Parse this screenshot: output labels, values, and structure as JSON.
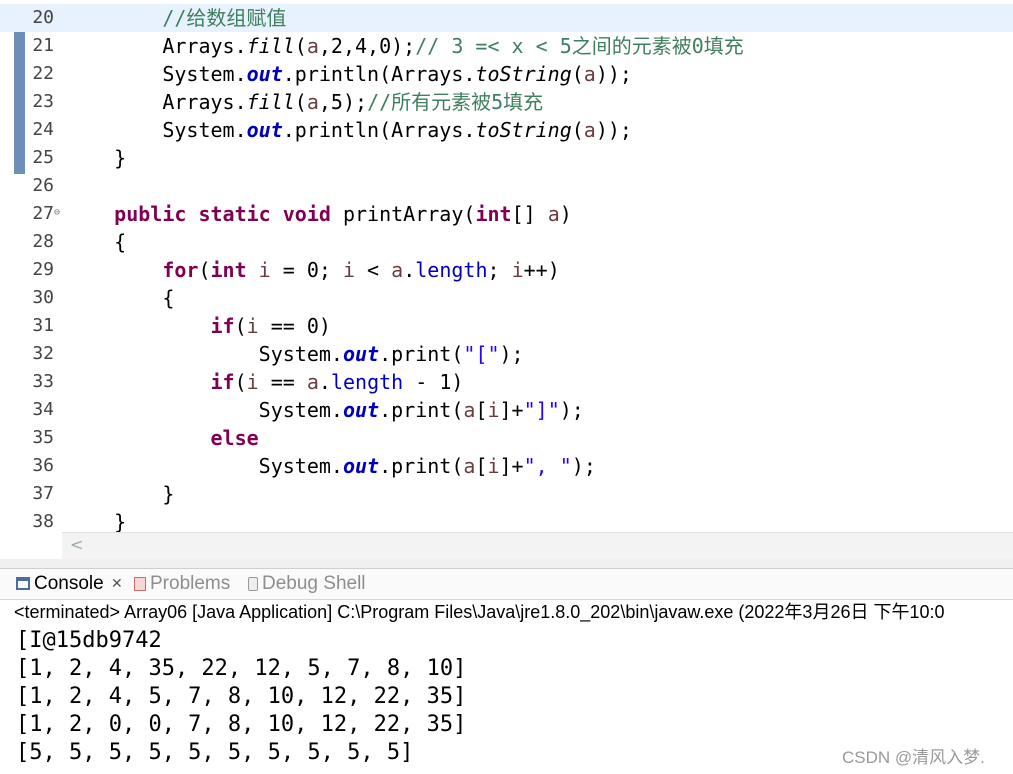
{
  "editor": {
    "lines": [
      {
        "num": "20",
        "tokens": [
          {
            "t": "        "
          },
          {
            "t": "//给数组赋值",
            "c": "cm"
          }
        ]
      },
      {
        "num": "21",
        "tokens": [
          {
            "t": "        Arrays."
          },
          {
            "t": "fill",
            "c": "sm"
          },
          {
            "t": "("
          },
          {
            "t": "a",
            "c": "pm"
          },
          {
            "t": ",2,4,0);"
          },
          {
            "t": "// 3 =< x < 5之间的元素被0填充",
            "c": "cm"
          }
        ]
      },
      {
        "num": "22",
        "tokens": [
          {
            "t": "        System."
          },
          {
            "t": "out",
            "c": "fld"
          },
          {
            "t": ".println(Arrays."
          },
          {
            "t": "toString",
            "c": "sm"
          },
          {
            "t": "("
          },
          {
            "t": "a",
            "c": "pm"
          },
          {
            "t": "));"
          }
        ]
      },
      {
        "num": "23",
        "tokens": [
          {
            "t": "        Arrays."
          },
          {
            "t": "fill",
            "c": "sm"
          },
          {
            "t": "("
          },
          {
            "t": "a",
            "c": "pm"
          },
          {
            "t": ",5);"
          },
          {
            "t": "//所有元素被5填充",
            "c": "cm"
          }
        ]
      },
      {
        "num": "24",
        "tokens": [
          {
            "t": "        System."
          },
          {
            "t": "out",
            "c": "fld"
          },
          {
            "t": ".println(Arrays."
          },
          {
            "t": "toString",
            "c": "sm"
          },
          {
            "t": "("
          },
          {
            "t": "a",
            "c": "pm"
          },
          {
            "t": "));"
          }
        ]
      },
      {
        "num": "25",
        "tokens": [
          {
            "t": "    }"
          }
        ]
      },
      {
        "num": "26",
        "tokens": []
      },
      {
        "num": "27",
        "fold": "⊖",
        "tokens": [
          {
            "t": "    "
          },
          {
            "t": "public",
            "c": "kw"
          },
          {
            "t": " "
          },
          {
            "t": "static",
            "c": "kw"
          },
          {
            "t": " "
          },
          {
            "t": "void",
            "c": "kw"
          },
          {
            "t": " printArray("
          },
          {
            "t": "int",
            "c": "kw"
          },
          {
            "t": "[] "
          },
          {
            "t": "a",
            "c": "pm"
          },
          {
            "t": ")"
          }
        ]
      },
      {
        "num": "28",
        "tokens": [
          {
            "t": "    {"
          }
        ]
      },
      {
        "num": "29",
        "tokens": [
          {
            "t": "        "
          },
          {
            "t": "for",
            "c": "kw"
          },
          {
            "t": "("
          },
          {
            "t": "int",
            "c": "kw"
          },
          {
            "t": " "
          },
          {
            "t": "i",
            "c": "lv"
          },
          {
            "t": " = 0; "
          },
          {
            "t": "i",
            "c": "lv"
          },
          {
            "t": " < "
          },
          {
            "t": "a",
            "c": "pm"
          },
          {
            "t": "."
          },
          {
            "t": "length",
            "c": "len"
          },
          {
            "t": "; "
          },
          {
            "t": "i",
            "c": "lv"
          },
          {
            "t": "++)"
          }
        ]
      },
      {
        "num": "30",
        "tokens": [
          {
            "t": "        {"
          }
        ]
      },
      {
        "num": "31",
        "tokens": [
          {
            "t": "            "
          },
          {
            "t": "if",
            "c": "kw"
          },
          {
            "t": "("
          },
          {
            "t": "i",
            "c": "lv"
          },
          {
            "t": " == 0)"
          }
        ]
      },
      {
        "num": "32",
        "tokens": [
          {
            "t": "                System."
          },
          {
            "t": "out",
            "c": "fld"
          },
          {
            "t": ".print("
          },
          {
            "t": "\"[\"",
            "c": "str"
          },
          {
            "t": ");"
          }
        ]
      },
      {
        "num": "33",
        "tokens": [
          {
            "t": "            "
          },
          {
            "t": "if",
            "c": "kw"
          },
          {
            "t": "("
          },
          {
            "t": "i",
            "c": "lv"
          },
          {
            "t": " == "
          },
          {
            "t": "a",
            "c": "pm"
          },
          {
            "t": "."
          },
          {
            "t": "length",
            "c": "len"
          },
          {
            "t": " - 1)"
          }
        ]
      },
      {
        "num": "34",
        "tokens": [
          {
            "t": "                System."
          },
          {
            "t": "out",
            "c": "fld"
          },
          {
            "t": ".print("
          },
          {
            "t": "a",
            "c": "pm"
          },
          {
            "t": "["
          },
          {
            "t": "i",
            "c": "lv"
          },
          {
            "t": "]+"
          },
          {
            "t": "\"]\"",
            "c": "str"
          },
          {
            "t": ");"
          }
        ]
      },
      {
        "num": "35",
        "tokens": [
          {
            "t": "            "
          },
          {
            "t": "else",
            "c": "kw"
          }
        ]
      },
      {
        "num": "36",
        "tokens": [
          {
            "t": "                System."
          },
          {
            "t": "out",
            "c": "fld"
          },
          {
            "t": ".print("
          },
          {
            "t": "a",
            "c": "pm"
          },
          {
            "t": "["
          },
          {
            "t": "i",
            "c": "lv"
          },
          {
            "t": "]+"
          },
          {
            "t": "\", \"",
            "c": "str"
          },
          {
            "t": ");"
          }
        ]
      },
      {
        "num": "37",
        "tokens": [
          {
            "t": "        }"
          }
        ]
      },
      {
        "num": "38",
        "tokens": [
          {
            "t": "    }"
          }
        ]
      }
    ],
    "scroll_left_glyph": "<"
  },
  "console": {
    "tabs": [
      {
        "label": "Console",
        "icon": "console-icon",
        "active": true
      },
      {
        "label": "Problems",
        "icon": "problems-icon",
        "active": false
      },
      {
        "label": "Debug Shell",
        "icon": "debug-shell-icon",
        "active": false
      }
    ],
    "close_glyph": "✕",
    "status": "<terminated> Array06 [Java Application] C:\\Program Files\\Java\\jre1.8.0_202\\bin\\javaw.exe (2022年3月26日 下午10:0",
    "output": [
      "[I@15db9742",
      "[1, 2, 4, 35, 22, 12, 5, 7, 8, 10]",
      "[1, 2, 4, 5, 7, 8, 10, 12, 22, 35]",
      "[1, 2, 0, 0, 7, 8, 10, 12, 22, 35]",
      "[5, 5, 5, 5, 5, 5, 5, 5, 5, 5]"
    ]
  },
  "watermark": "CSDN @清风入梦.",
  "colors": {
    "keyword": "#7f0055",
    "comment": "#3f7f5f",
    "string": "#2a00ff",
    "field": "#0000c0",
    "local_var": "#6a3e3e",
    "current_line": "#e8f2fe"
  }
}
